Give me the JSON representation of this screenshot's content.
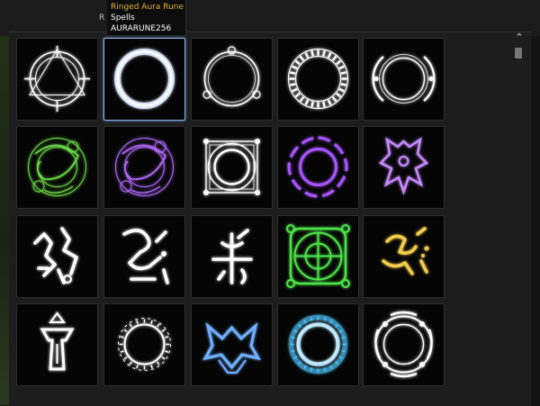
{
  "tooltip": {
    "name": "Ringed Aura Rune",
    "category": "Spells",
    "code": "AURARUNE256"
  },
  "hidden_label": "R",
  "scrollbar": {
    "up_glyph": "⌃"
  },
  "tiles": [
    {
      "name": "rune-compass-circle",
      "color": "#ffffff"
    },
    {
      "name": "rune-ringed-aura",
      "color": "#ffffff"
    },
    {
      "name": "rune-triple-knot-ring",
      "color": "#ffffff"
    },
    {
      "name": "rune-glyph-band-ring",
      "color": "#ffffff"
    },
    {
      "name": "rune-split-arc-ring",
      "color": "#ffffff"
    },
    {
      "name": "rune-green-swirl",
      "color": "#6fe04a"
    },
    {
      "name": "rune-violet-swirl",
      "color": "#b46bff"
    },
    {
      "name": "rune-square-frame-ring",
      "color": "#ffffff"
    },
    {
      "name": "rune-purple-hexagram",
      "color": "#a855ff"
    },
    {
      "name": "rune-purple-totem",
      "color": "#c98bff"
    },
    {
      "name": "rune-sigil-hook",
      "color": "#ffffff"
    },
    {
      "name": "rune-sigil-serpent",
      "color": "#ffffff"
    },
    {
      "name": "rune-sigil-cross",
      "color": "#ffffff"
    },
    {
      "name": "rune-green-mandala",
      "color": "#4ee34a"
    },
    {
      "name": "rune-gold-sigil",
      "color": "#f2cc4a"
    },
    {
      "name": "rune-white-totem",
      "color": "#ffffff"
    },
    {
      "name": "rune-script-ring",
      "color": "#ffffff"
    },
    {
      "name": "rune-blue-crest",
      "color": "#6fb0ff"
    },
    {
      "name": "rune-cyan-script-ring",
      "color": "#4fc8ff"
    },
    {
      "name": "rune-thorned-ring",
      "color": "#ffffff"
    }
  ]
}
